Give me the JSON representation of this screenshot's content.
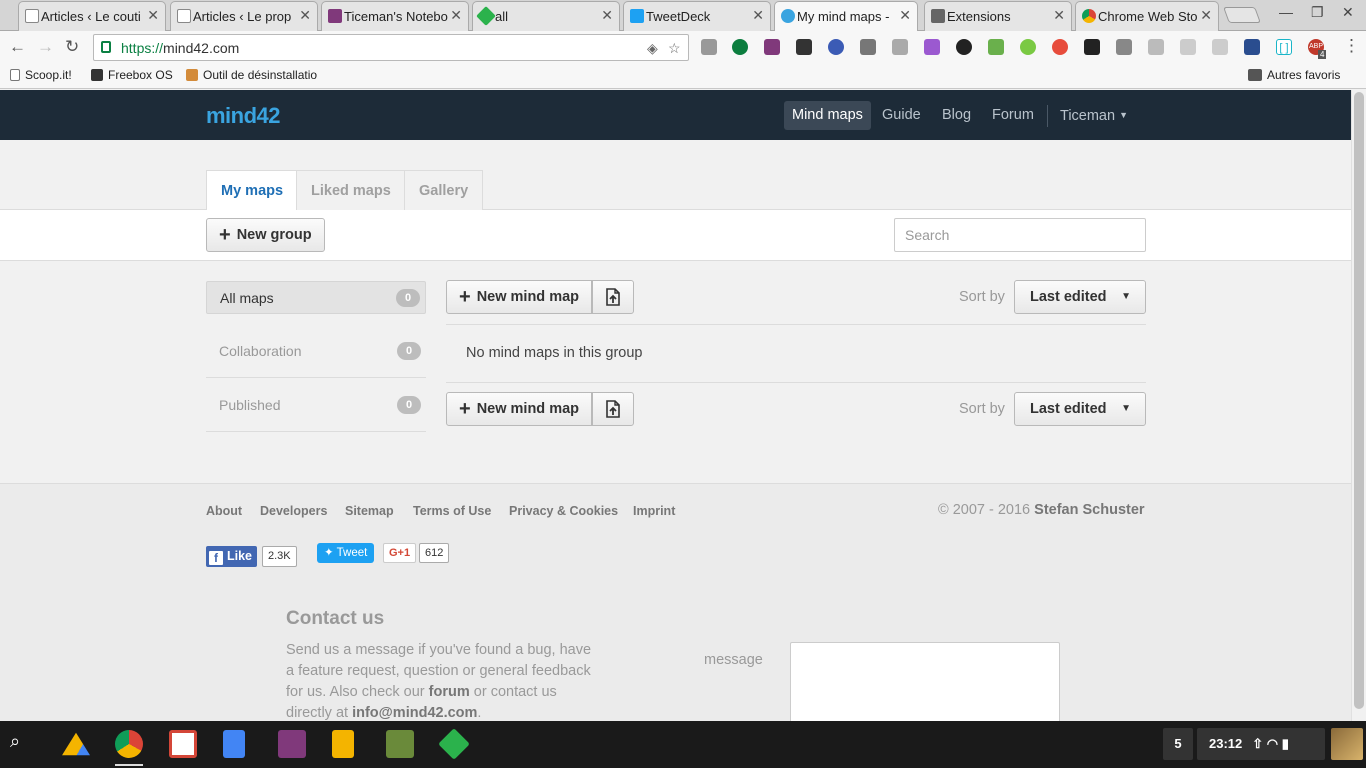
{
  "browser": {
    "tabs": [
      {
        "title": "Articles ‹ Le couti",
        "favicon": "page-icon",
        "color": "#cccccc"
      },
      {
        "title": "Articles ‹ Le prop",
        "favicon": "page-icon",
        "color": "#cccccc"
      },
      {
        "title": "Ticeman's Notebo",
        "favicon": "onenote-icon",
        "color": "#80397b"
      },
      {
        "title": "all",
        "favicon": "feedly-icon",
        "color": "#2bb24c"
      },
      {
        "title": "TweetDeck",
        "favicon": "tweetdeck-icon",
        "color": "#1da1f2"
      },
      {
        "title": "My mind maps -",
        "favicon": "mind42-icon",
        "color": "#3aa4e0"
      },
      {
        "title": "Extensions",
        "favicon": "puzzle-icon",
        "color": "#666666"
      },
      {
        "title": "Chrome Web Sto",
        "favicon": "webstore-icon",
        "color": "#e8a33d"
      }
    ],
    "url_scheme": "https://",
    "url_host": "mind42.com",
    "bookmarks": [
      {
        "label": "Scoop.it!"
      },
      {
        "label": "Freebox OS"
      },
      {
        "label": "Outil de désinstallatio"
      }
    ],
    "other_bookmarks": "Autres favoris",
    "ext_badge": "4"
  },
  "app": {
    "logo": "mind42",
    "nav": {
      "mind_maps": "Mind maps",
      "guide": "Guide",
      "blog": "Blog",
      "forum": "Forum",
      "user": "Ticeman"
    },
    "tabs": {
      "my_maps": "My maps",
      "liked_maps": "Liked maps",
      "gallery": "Gallery"
    },
    "new_group": "New group",
    "search_placeholder": "Search",
    "groups": [
      {
        "label": "All maps",
        "count": "0"
      },
      {
        "label": "Collaboration",
        "count": "0"
      },
      {
        "label": "Published",
        "count": "0"
      }
    ],
    "new_mind_map": "New mind map",
    "sort_label": "Sort by",
    "sort_value": "Last edited",
    "empty_text": "No mind maps in this group"
  },
  "footer": {
    "links": {
      "about": "About",
      "developers": "Developers",
      "sitemap": "Sitemap",
      "terms": "Terms of Use",
      "privacy": "Privacy & Cookies",
      "imprint": "Imprint"
    },
    "copyright_prefix": "© 2007 - 2016",
    "copyright_owner": "Stefan Schuster",
    "like_label": "Like",
    "like_count": "2.3K",
    "tweet_label": "Tweet",
    "gplus_label": "G+1",
    "gplus_count": "612",
    "contact_title": "Contact us",
    "contact_text_1": "Send us a message if you've found a bug, have a feature request, question or general feedback for us. Also check our",
    "contact_forum": "forum",
    "contact_text_2": "or contact us directly at",
    "contact_email": "info@mind42.com",
    "contact_text_3": ".",
    "message_label": "message"
  },
  "shelf": {
    "notifications": "5",
    "time": "23:12"
  }
}
